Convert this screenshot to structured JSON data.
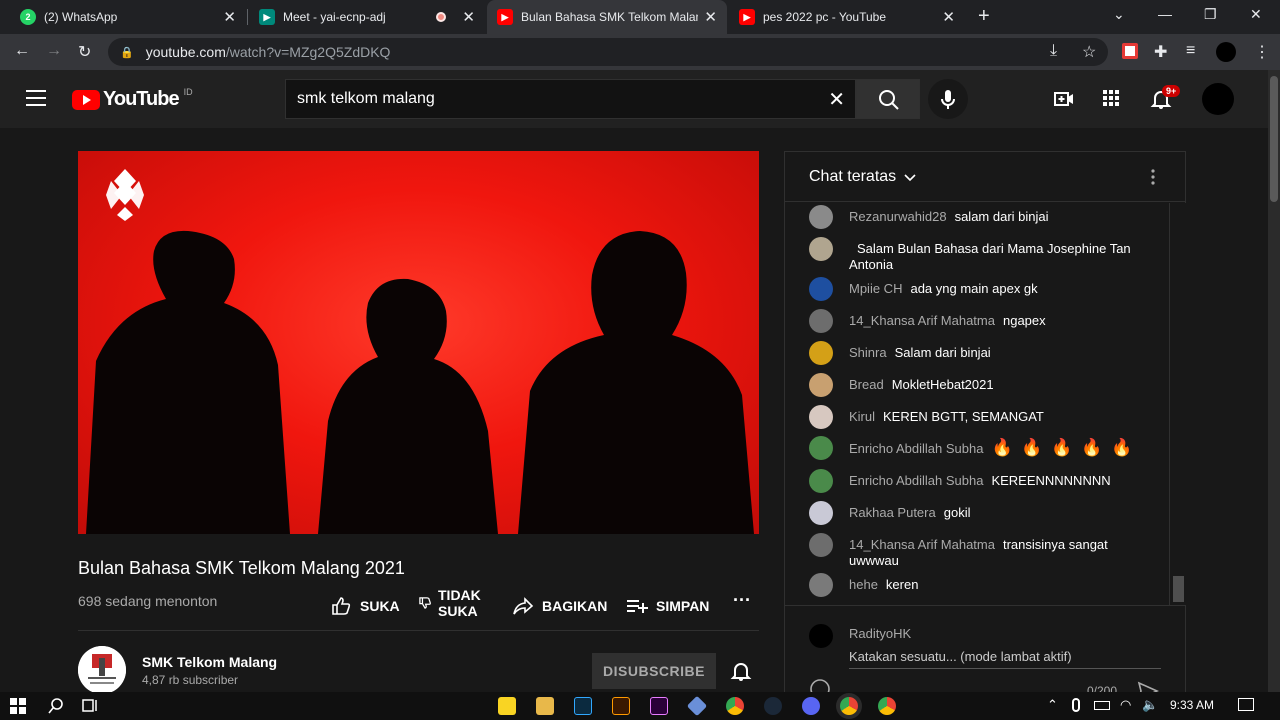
{
  "browser": {
    "tabs": [
      {
        "title": "(2) WhatsApp",
        "icon": "whatsapp-icon",
        "color": "#25d366"
      },
      {
        "title": "Meet - yai-ecnp-adj",
        "icon": "meet-icon",
        "color": "#00897b"
      },
      {
        "title": "Bulan Bahasa SMK Telkom Malang",
        "icon": "youtube-icon",
        "color": "#ff0000"
      },
      {
        "title": "pes 2022 pc - YouTube",
        "icon": "youtube-icon",
        "color": "#ff0000"
      }
    ],
    "url_host": "youtube.com",
    "url_path": "/watch?v=MZg2Q5ZdDKQ"
  },
  "youtube": {
    "logo_text": "YouTube",
    "country": "ID",
    "search_value": "smk telkom malang",
    "notification_badge": "9+"
  },
  "video": {
    "title": "Bulan Bahasa SMK Telkom Malang 2021",
    "viewers": "698 sedang menonton",
    "like_label": "SUKA",
    "dislike_label_1": "TIDAK",
    "dislike_label_2": "SUKA",
    "share_label": "BAGIKAN",
    "save_label": "SIMPAN"
  },
  "channel": {
    "name": "SMK Telkom Malang",
    "subscribers": "4,87 rb subscriber",
    "unsubscribe_label": "DISUBSCRIBE"
  },
  "chat": {
    "header": "Chat teratas",
    "messages": [
      {
        "author": "Rezanurwahid28",
        "text": "salam dari binjai",
        "avatar_color": "#8a8a8a"
      },
      {
        "author": "",
        "text": "Salam Bulan Bahasa dari Mama Josephine Tan Antonia",
        "avatar_color": "#b0a58f"
      },
      {
        "author": "Mpiie CH",
        "text": "ada yng main apex gk",
        "avatar_color": "#1e4fa0"
      },
      {
        "author": "14_Khansa Arif Mahatma",
        "text": "ngapex",
        "avatar_color": "#6d6d6d"
      },
      {
        "author": "Shinra",
        "text": "Salam dari binjai",
        "avatar_color": "#d4a017"
      },
      {
        "author": "Bread",
        "text": "MokletHebat2021",
        "avatar_color": "#c8a070"
      },
      {
        "author": "Kirul",
        "text": "KEREN BGTT, SEMANGAT",
        "avatar_color": "#d7c8c0"
      },
      {
        "author": "Enricho Abdillah Subha",
        "text": "🔥 🔥 🔥 🔥 🔥",
        "avatar_color": "#4a8a4a"
      },
      {
        "author": "Enricho Abdillah Subha",
        "text": "KEREENNNNNNNN",
        "avatar_color": "#4a8a4a"
      },
      {
        "author": "Rakhaa Putera",
        "text": "gokil",
        "avatar_color": "#c9c9d6"
      },
      {
        "author": "14_Khansa Arif Mahatma",
        "text": "transisinya sangat uwwwau",
        "avatar_color": "#6d6d6d"
      },
      {
        "author": "hehe",
        "text": "keren",
        "avatar_color": "#7a7a7a"
      }
    ],
    "input_user": "RadityoHK",
    "input_placeholder": "Katakan sesuatu... (mode lambat aktif)",
    "char_counter": "0/200"
  },
  "taskbar": {
    "time": "9:33 AM"
  }
}
